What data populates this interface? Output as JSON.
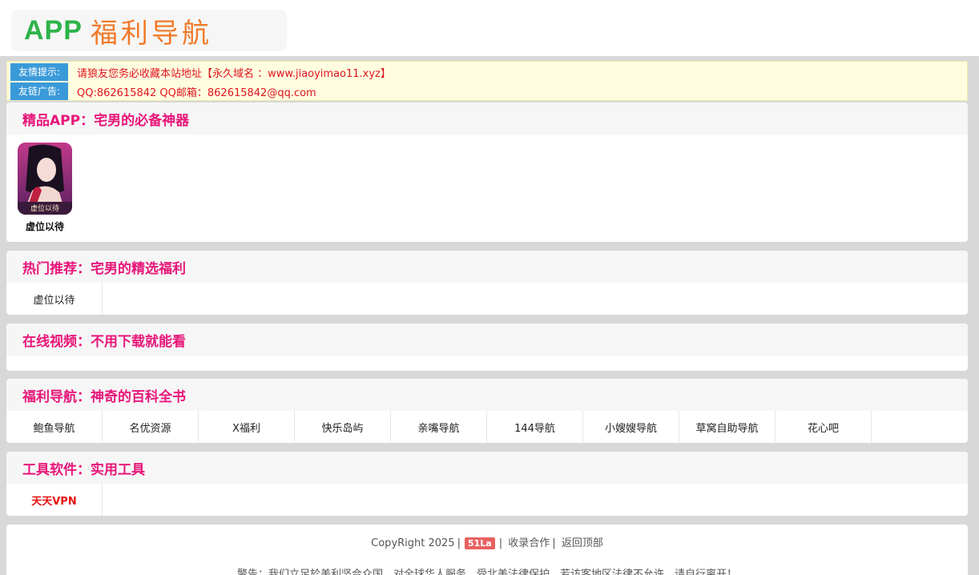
{
  "header": {
    "logo_app": "APP",
    "logo_cn": "福利导航"
  },
  "notice": {
    "tip_label": "友情提示:",
    "tip_text": "请狼友您务必收藏本站地址【永久域名 ：www.jiaoyimao11.xyz】",
    "ad_label": "友链广告:",
    "ad_text": "QQ:862615842 QQ邮箱：862615842@qq.com"
  },
  "sections": {
    "apps": {
      "title": "精品APP：宅男的必备神器",
      "items": [
        {
          "name": "虚位以待",
          "icon": "app-icon-anime-girl"
        }
      ]
    },
    "hot": {
      "title": "热门推荐：宅男的精选福利",
      "links": [
        "虚位以待"
      ]
    },
    "video": {
      "title": "在线视频：不用下载就能看",
      "links": []
    },
    "nav": {
      "title": "福利导航：神奇的百科全书",
      "links": [
        "鲍鱼导航",
        "名优资源",
        "X福利",
        "快乐岛屿",
        "亲嘴导航",
        "144导航",
        "小嫂嫂导航",
        "草窝自助导航",
        "花心吧"
      ]
    },
    "tools": {
      "title": "工具软件：实用工具",
      "links": [
        "天天VPN"
      ]
    }
  },
  "footer": {
    "copyright": "CopyRight 2025",
    "badge": "51La",
    "cooperate": "收录合作",
    "back_top": "返回顶部",
    "warning": "警告：我们立足於美利坚合众国，对全球华人服务，受北美法律保护。若访客地区法律不允许，请自行离开！"
  },
  "colors": {
    "accent_title": "#e8177a",
    "notice_tag": "#3a9ad9",
    "notice_text": "#e0141e",
    "logo_green": "#2db34a",
    "logo_orange": "#f07a28"
  }
}
